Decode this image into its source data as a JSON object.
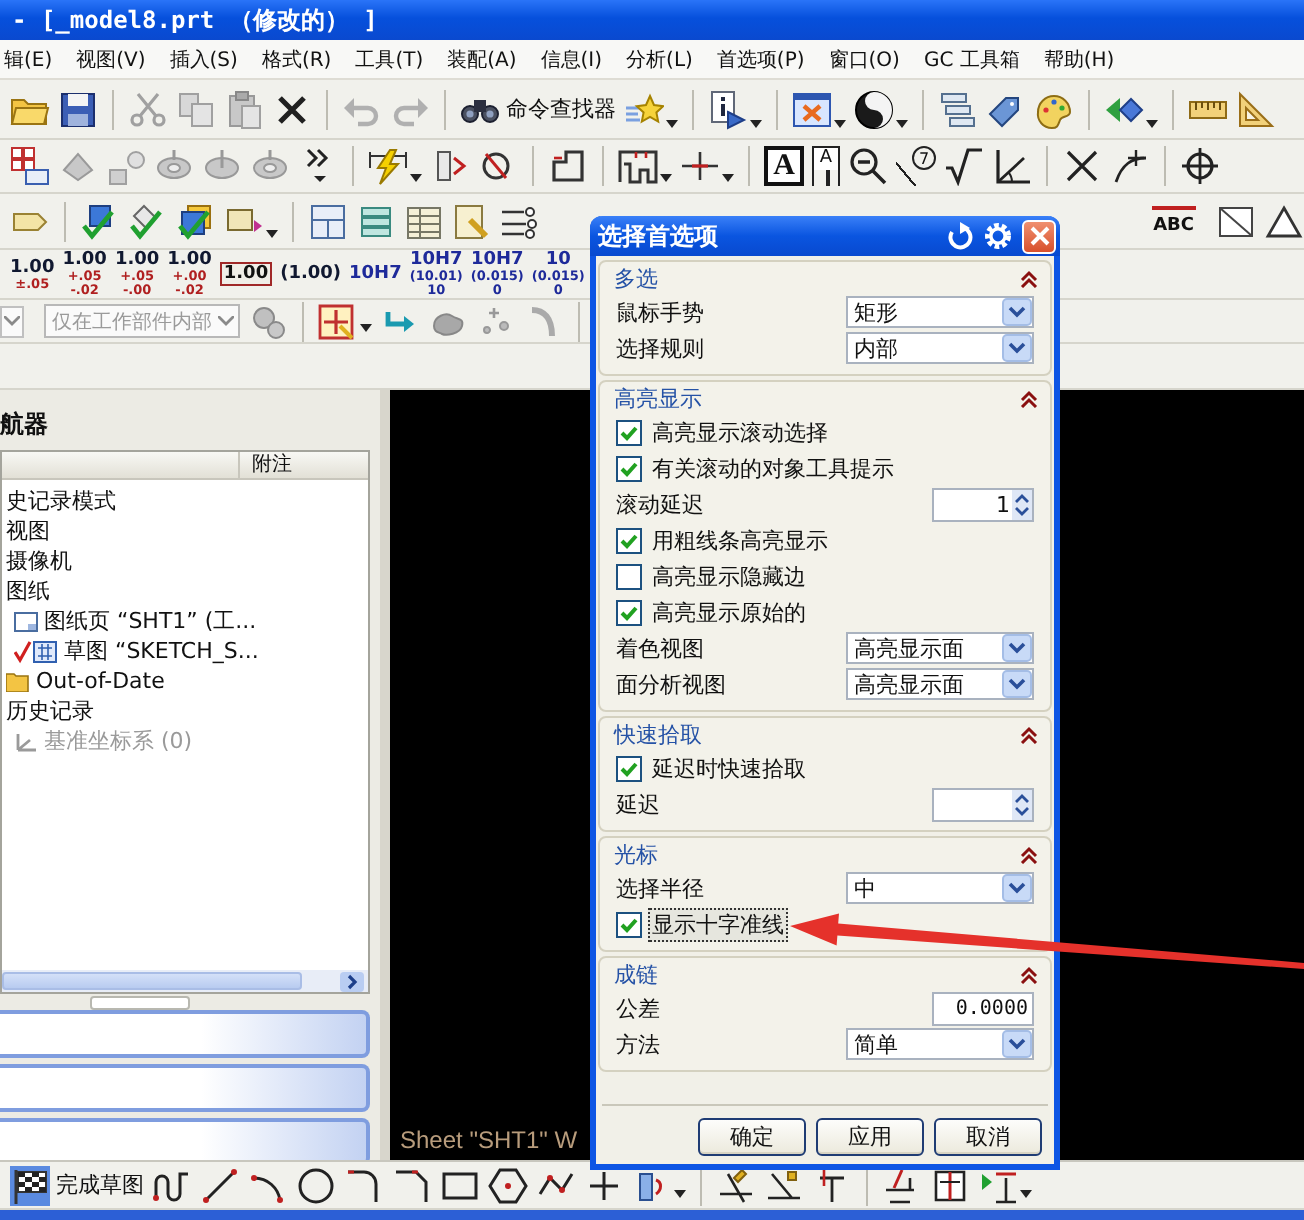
{
  "window": {
    "title": "- [_model8.prt （修改的） ]"
  },
  "menu_bar": [
    "辑(E)",
    "视图(V)",
    "插入(S)",
    "格式(R)",
    "工具(T)",
    "装配(A)",
    "信息(I)",
    "分析(L)",
    "首选项(P)",
    "窗口(O)",
    "GC 工具箱",
    "帮助(H)"
  ],
  "toolbar": {
    "command_finder": "命令查找器"
  },
  "drafting_toolbar": {
    "boxed_letter": "A",
    "tag_letter": "A",
    "balloon_number": "7",
    "text_letters": "ABC"
  },
  "tolerance_buttons": [
    {
      "kind": "tolerance",
      "value": "1.00",
      "limits": [
        "±.05"
      ]
    },
    {
      "kind": "tolerance",
      "value": "1.00",
      "limits": [
        "+.05",
        "-.02"
      ]
    },
    {
      "kind": "tolerance",
      "value": "1.00",
      "limits": [
        "+.05",
        "-.00"
      ]
    },
    {
      "kind": "tolerance",
      "value": "1.00",
      "limits": [
        "+.00",
        "-.02"
      ]
    },
    {
      "kind": "boxed",
      "value": "1.00"
    },
    {
      "kind": "plain",
      "value": "(1.00)"
    },
    {
      "kind": "fit",
      "value": "10H7"
    },
    {
      "kind": "fit",
      "value": "10H7",
      "limits": [
        "(10.01)",
        "10"
      ]
    },
    {
      "kind": "fit",
      "value": "10H7",
      "limits": [
        "(0.015)",
        "0"
      ]
    },
    {
      "kind": "fit",
      "value": "10",
      "limits": [
        "(0.015)",
        "0"
      ]
    }
  ],
  "selection_bar": {
    "scope": {
      "label": "仅在工作部件内部",
      "disabled": true
    }
  },
  "navigator": {
    "title": "航器",
    "column": "附注",
    "items": [
      {
        "label": "史记录模式",
        "kind": "text",
        "disabled": false
      },
      {
        "label": "视图",
        "kind": "text",
        "disabled": false
      },
      {
        "label": "摄像机",
        "kind": "text",
        "disabled": false
      },
      {
        "label": "图纸",
        "kind": "text",
        "disabled": false,
        "children": [
          {
            "label": "图纸页 “SHT1” (工...",
            "kind": "sheet",
            "disabled": false
          },
          {
            "label": "草图 “SKETCH_S...",
            "kind": "sketch",
            "disabled": false
          }
        ]
      },
      {
        "label": "Out-of-Date",
        "kind": "folder",
        "disabled": false
      },
      {
        "label": "历史记录",
        "kind": "text",
        "disabled": false,
        "children": [
          {
            "label": "基准坐标系 (0)",
            "kind": "datum",
            "disabled": true
          }
        ]
      }
    ]
  },
  "graphics": {
    "sheet_label": "Sheet \"SHT1\" W"
  },
  "dialog": {
    "title": "选择首选项",
    "sections": [
      {
        "title": "多选",
        "expanded": true,
        "rows": [
          {
            "kind": "dropdown",
            "label": "鼠标手势",
            "value": "矩形"
          },
          {
            "kind": "dropdown",
            "label": "选择规则",
            "value": "内部"
          }
        ]
      },
      {
        "title": "高亮显示",
        "expanded": true,
        "rows": [
          {
            "kind": "checkbox",
            "label": "高亮显示滚动选择",
            "checked": true,
            "focused": false
          },
          {
            "kind": "checkbox",
            "label": "有关滚动的对象工具提示",
            "checked": true,
            "focused": false
          },
          {
            "kind": "spinner",
            "label": "滚动延迟",
            "value": "1"
          },
          {
            "kind": "checkbox",
            "label": "用粗线条高亮显示",
            "checked": true,
            "focused": false
          },
          {
            "kind": "checkbox",
            "label": "高亮显示隐藏边",
            "checked": false,
            "focused": false
          },
          {
            "kind": "checkbox",
            "label": "高亮显示原始的",
            "checked": true,
            "focused": false
          },
          {
            "kind": "dropdown",
            "label": "着色视图",
            "value": "高亮显示面"
          },
          {
            "kind": "dropdown",
            "label": "面分析视图",
            "value": "高亮显示面"
          }
        ]
      },
      {
        "title": "快速拾取",
        "expanded": true,
        "rows": [
          {
            "kind": "checkbox",
            "label": "延迟时快速拾取",
            "checked": true,
            "focused": false
          },
          {
            "kind": "spinner",
            "label": "延迟"
          }
        ]
      },
      {
        "title": "光标",
        "expanded": true,
        "rows": [
          {
            "kind": "dropdown",
            "label": "选择半径",
            "value": "中"
          },
          {
            "kind": "checkbox",
            "label": "显示十字准线",
            "checked": true,
            "focused": true
          }
        ]
      },
      {
        "title": "成链",
        "expanded": true,
        "rows": [
          {
            "kind": "number",
            "label": "公差",
            "value": "0.0000"
          },
          {
            "kind": "dropdown",
            "label": "方法",
            "value": "简单"
          }
        ]
      }
    ],
    "buttons": [
      "确定",
      "应用",
      "取消"
    ]
  },
  "sketch_toolbar": {
    "finish_button": "完成草图"
  }
}
